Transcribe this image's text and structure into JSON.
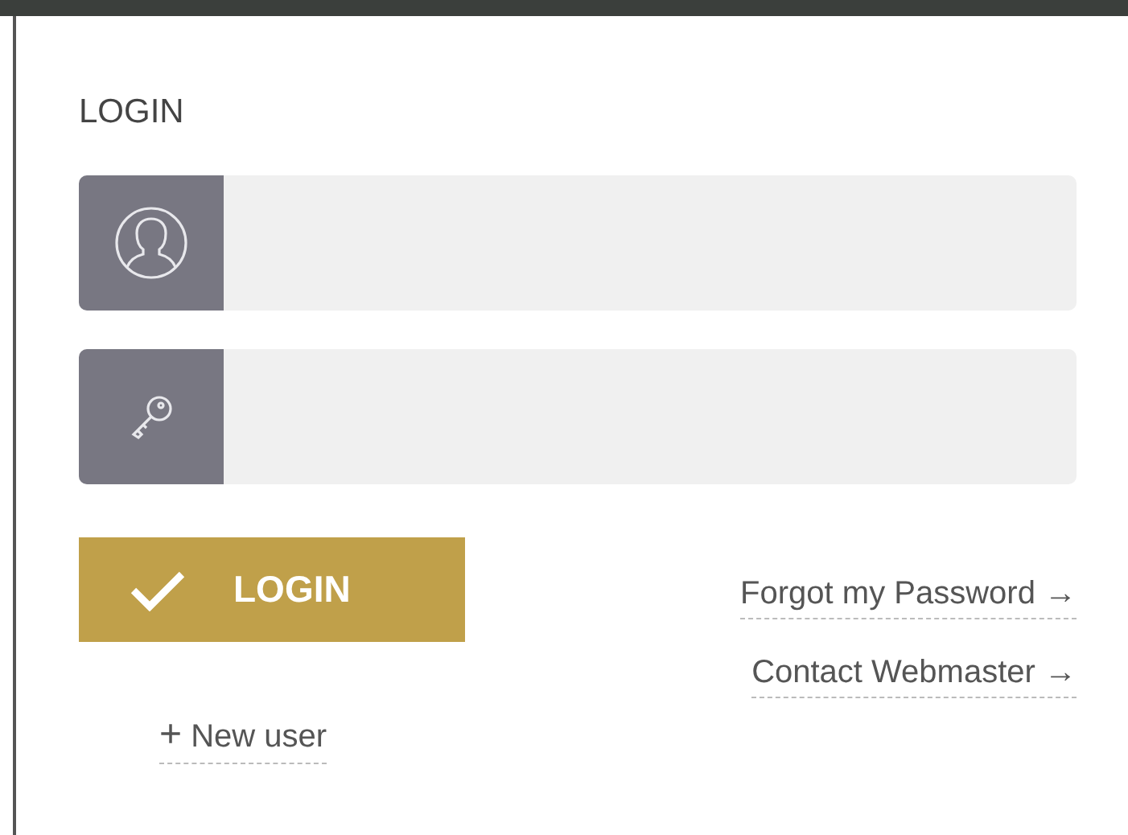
{
  "dialog": {
    "title": "LOGIN",
    "fields": [
      {
        "kind": "user"
      },
      {
        "kind": "password"
      }
    ],
    "login_button": "LOGIN",
    "links": [
      {
        "label": "Forgot my Password",
        "arrow": "→"
      },
      {
        "label": "Contact Webmaster",
        "arrow": "→"
      }
    ],
    "new_user": {
      "icon": "+",
      "label": "New user"
    }
  }
}
